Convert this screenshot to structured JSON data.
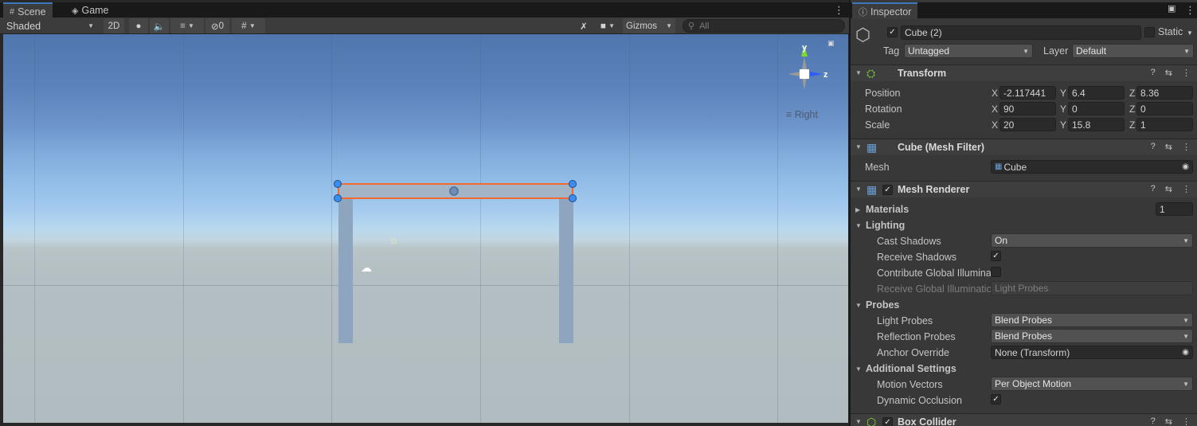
{
  "scene_tabs": [
    {
      "label": "Scene",
      "icon": "grid-icon"
    },
    {
      "label": "Game",
      "icon": "gamepad-icon"
    }
  ],
  "scene_toolbar": {
    "shading_mode": "Shaded",
    "mode_2d": "2D",
    "hidden_count": "0",
    "gizmos_label": "Gizmos",
    "search_placeholder": "All"
  },
  "viewport": {
    "orientation_label": "Right",
    "axis_labels": {
      "y": "y",
      "z": "z"
    }
  },
  "inspector": {
    "tab_label": "Inspector",
    "object_name": "Cube (2)",
    "active": true,
    "static_label": "Static",
    "tag_label": "Tag",
    "tag_value": "Untagged",
    "layer_label": "Layer",
    "layer_value": "Default",
    "transform": {
      "title": "Transform",
      "rows": [
        {
          "label": "Position",
          "x": "-2.117441",
          "y": "6.4",
          "z": "8.36"
        },
        {
          "label": "Rotation",
          "x": "90",
          "y": "0",
          "z": "0"
        },
        {
          "label": "Scale",
          "x": "20",
          "y": "15.8",
          "z": "1"
        }
      ],
      "axis": {
        "x": "X",
        "y": "Y",
        "z": "Z"
      }
    },
    "mesh_filter": {
      "title": "Cube (Mesh Filter)",
      "mesh_label": "Mesh",
      "mesh_value": "Cube"
    },
    "mesh_renderer": {
      "title": "Mesh Renderer",
      "enabled": true,
      "materials_label": "Materials",
      "materials_count": "1",
      "lighting_label": "Lighting",
      "cast_shadows_label": "Cast Shadows",
      "cast_shadows_value": "On",
      "receive_shadows_label": "Receive Shadows",
      "receive_shadows": true,
      "contribute_gi_label": "Contribute Global Illumina",
      "contribute_gi": false,
      "receive_gi_label": "Receive Global Illuminatic",
      "receive_gi_value": "Light Probes",
      "probes_label": "Probes",
      "light_probes_label": "Light Probes",
      "light_probes_value": "Blend Probes",
      "reflection_probes_label": "Reflection Probes",
      "reflection_probes_value": "Blend Probes",
      "anchor_override_label": "Anchor Override",
      "anchor_override_value": "None (Transform)",
      "additional_settings_label": "Additional Settings",
      "motion_vectors_label": "Motion Vectors",
      "motion_vectors_value": "Per Object Motion",
      "dynamic_occlusion_label": "Dynamic Occlusion",
      "dynamic_occlusion": true
    },
    "box_collider": {
      "title": "Box Collider",
      "enabled": true
    }
  },
  "colors": {
    "selection_outline": "#f26a2e",
    "tab_accent": "#3a79bb",
    "handle_blue": "#3b8df0"
  }
}
